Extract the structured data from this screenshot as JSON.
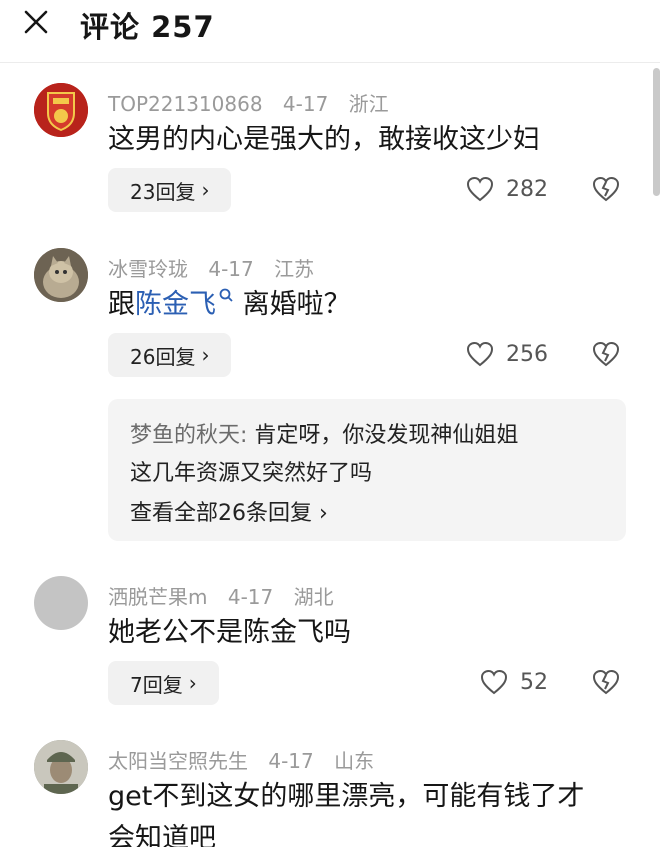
{
  "header": {
    "title": "评论 257"
  },
  "comments": [
    {
      "user": "TOP221310868",
      "date": "4-17",
      "location": "浙江",
      "text": "这男的内心是强大的，敢接收这少妇",
      "replies_label": "23回复",
      "likes": "282"
    },
    {
      "user": "冰雪玲珑",
      "date": "4-17",
      "location": "江苏",
      "text_before": "跟",
      "text_link": "陈金飞",
      "text_after": " 离婚啦？",
      "replies_label": "26回复",
      "likes": "256",
      "sub_reply": {
        "author": "梦鱼的秋天:",
        "line1": " 肯定呀，你没发现神仙姐姐",
        "line2": "这几年资源又突然好了吗",
        "see_all": "查看全部26条回复"
      }
    },
    {
      "user": "洒脱芒果m",
      "date": "4-17",
      "location": "湖北",
      "text": "她老公不是陈金飞吗",
      "replies_label": "7回复",
      "likes": "52"
    },
    {
      "user": "太阳当空照先生",
      "date": "4-17",
      "location": "山东",
      "text": "get不到这女的哪里漂亮，可能有钱了才",
      "text_line2": "会知道吧"
    }
  ],
  "icons": [
    "close-icon",
    "chevron-right-icon",
    "heart-icon",
    "broken-heart-icon",
    "search-link-icon"
  ]
}
